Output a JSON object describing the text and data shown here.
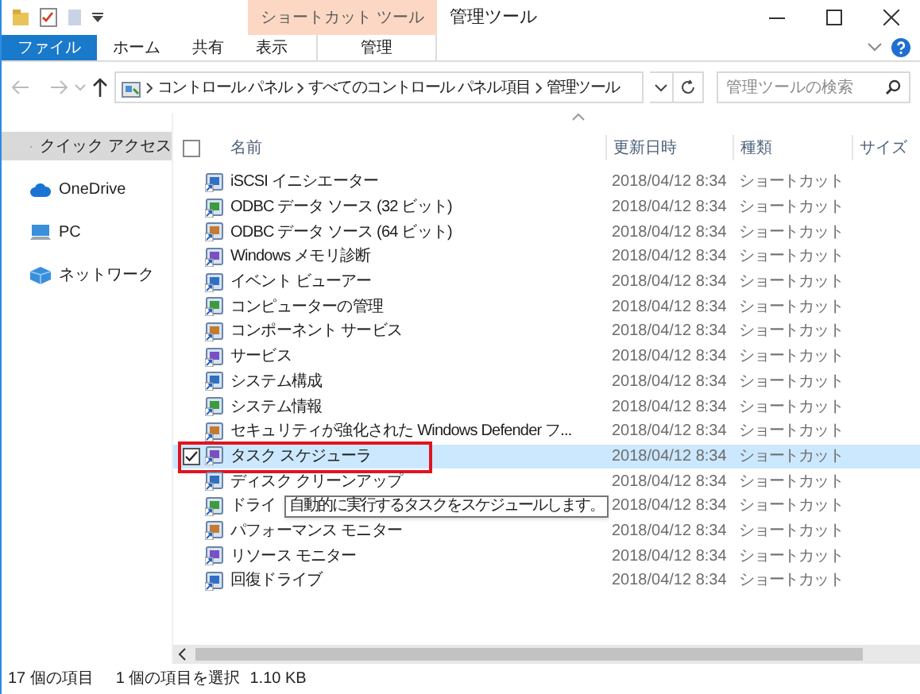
{
  "window": {
    "title": "管理ツール"
  },
  "ribbon": {
    "context_tab": "ショートカット ツール",
    "tabs": [
      {
        "label": "ファイル",
        "kind": "file"
      },
      {
        "label": "ホーム",
        "kind": "normal"
      },
      {
        "label": "共有",
        "kind": "normal"
      },
      {
        "label": "表示",
        "kind": "normal"
      },
      {
        "label": "管理",
        "kind": "context"
      }
    ]
  },
  "address_bar": {
    "breadcrumbs": [
      "コントロール パネル",
      "すべてのコントロール パネル項目",
      "管理ツール"
    ]
  },
  "search": {
    "placeholder": "管理ツールの検索"
  },
  "navigation_pane": {
    "items": [
      {
        "label": "クイック アクセス",
        "kind": "quick",
        "selected": true
      },
      {
        "label": "OneDrive",
        "kind": "cloud",
        "selected": false
      },
      {
        "label": "PC",
        "kind": "pc",
        "selected": false
      },
      {
        "label": "ネットワーク",
        "kind": "network",
        "selected": false
      }
    ]
  },
  "file_list": {
    "all_selected": false,
    "columns": [
      "名前",
      "更新日時",
      "種類",
      "サイズ"
    ],
    "rows": [
      {
        "name": "iSCSI イニシエーター",
        "modified": "2018/04/12 8:34",
        "type": "ショートカット",
        "selected": false,
        "checked": false,
        "outlined": false
      },
      {
        "name": "ODBC データ ソース (32 ビット)",
        "modified": "2018/04/12 8:34",
        "type": "ショートカット",
        "selected": false,
        "checked": false,
        "outlined": false
      },
      {
        "name": "ODBC データ ソース (64 ビット)",
        "modified": "2018/04/12 8:34",
        "type": "ショートカット",
        "selected": false,
        "checked": false,
        "outlined": false
      },
      {
        "name": "Windows メモリ診断",
        "modified": "2018/04/12 8:34",
        "type": "ショートカット",
        "selected": false,
        "checked": false,
        "outlined": false
      },
      {
        "name": "イベント ビューアー",
        "modified": "2018/04/12 8:34",
        "type": "ショートカット",
        "selected": false,
        "checked": false,
        "outlined": false
      },
      {
        "name": "コンピューターの管理",
        "modified": "2018/04/12 8:34",
        "type": "ショートカット",
        "selected": false,
        "checked": false,
        "outlined": false
      },
      {
        "name": "コンポーネント サービス",
        "modified": "2018/04/12 8:34",
        "type": "ショートカット",
        "selected": false,
        "checked": false,
        "outlined": false
      },
      {
        "name": "サービス",
        "modified": "2018/04/12 8:34",
        "type": "ショートカット",
        "selected": false,
        "checked": false,
        "outlined": false
      },
      {
        "name": "システム構成",
        "modified": "2018/04/12 8:34",
        "type": "ショートカット",
        "selected": false,
        "checked": false,
        "outlined": false
      },
      {
        "name": "システム情報",
        "modified": "2018/04/12 8:34",
        "type": "ショートカット",
        "selected": false,
        "checked": false,
        "outlined": false
      },
      {
        "name": "セキュリティが強化された Windows Defender フ...",
        "modified": "2018/04/12 8:34",
        "type": "ショートカット",
        "selected": false,
        "checked": false,
        "outlined": false
      },
      {
        "name": "タスク スケジューラ",
        "modified": "2018/04/12 8:34",
        "type": "ショートカット",
        "selected": true,
        "checked": true,
        "outlined": true
      },
      {
        "name": "ディスク クリーンアップ",
        "modified": "2018/04/12 8:34",
        "type": "ショートカット",
        "selected": false,
        "checked": false,
        "outlined": false
      },
      {
        "name": "ドライ",
        "modified": "2018/04/12 8:34",
        "type": "ショートカット",
        "selected": false,
        "checked": false,
        "outlined": false
      },
      {
        "name": "パフォーマンス モニター",
        "modified": "2018/04/12 8:34",
        "type": "ショートカット",
        "selected": false,
        "checked": false,
        "outlined": false
      },
      {
        "name": "リソース モニター",
        "modified": "2018/04/12 8:34",
        "type": "ショートカット",
        "selected": false,
        "checked": false,
        "outlined": false
      },
      {
        "name": "回復ドライブ",
        "modified": "2018/04/12 8:34",
        "type": "ショートカット",
        "selected": false,
        "checked": false,
        "outlined": false
      }
    ]
  },
  "tooltip": "自動的に実行するタスクをスケジュールします。",
  "status_bar": {
    "item_count": "17 個の項目",
    "selection": "1 個の項目を選択",
    "size": "1.10 KB"
  }
}
